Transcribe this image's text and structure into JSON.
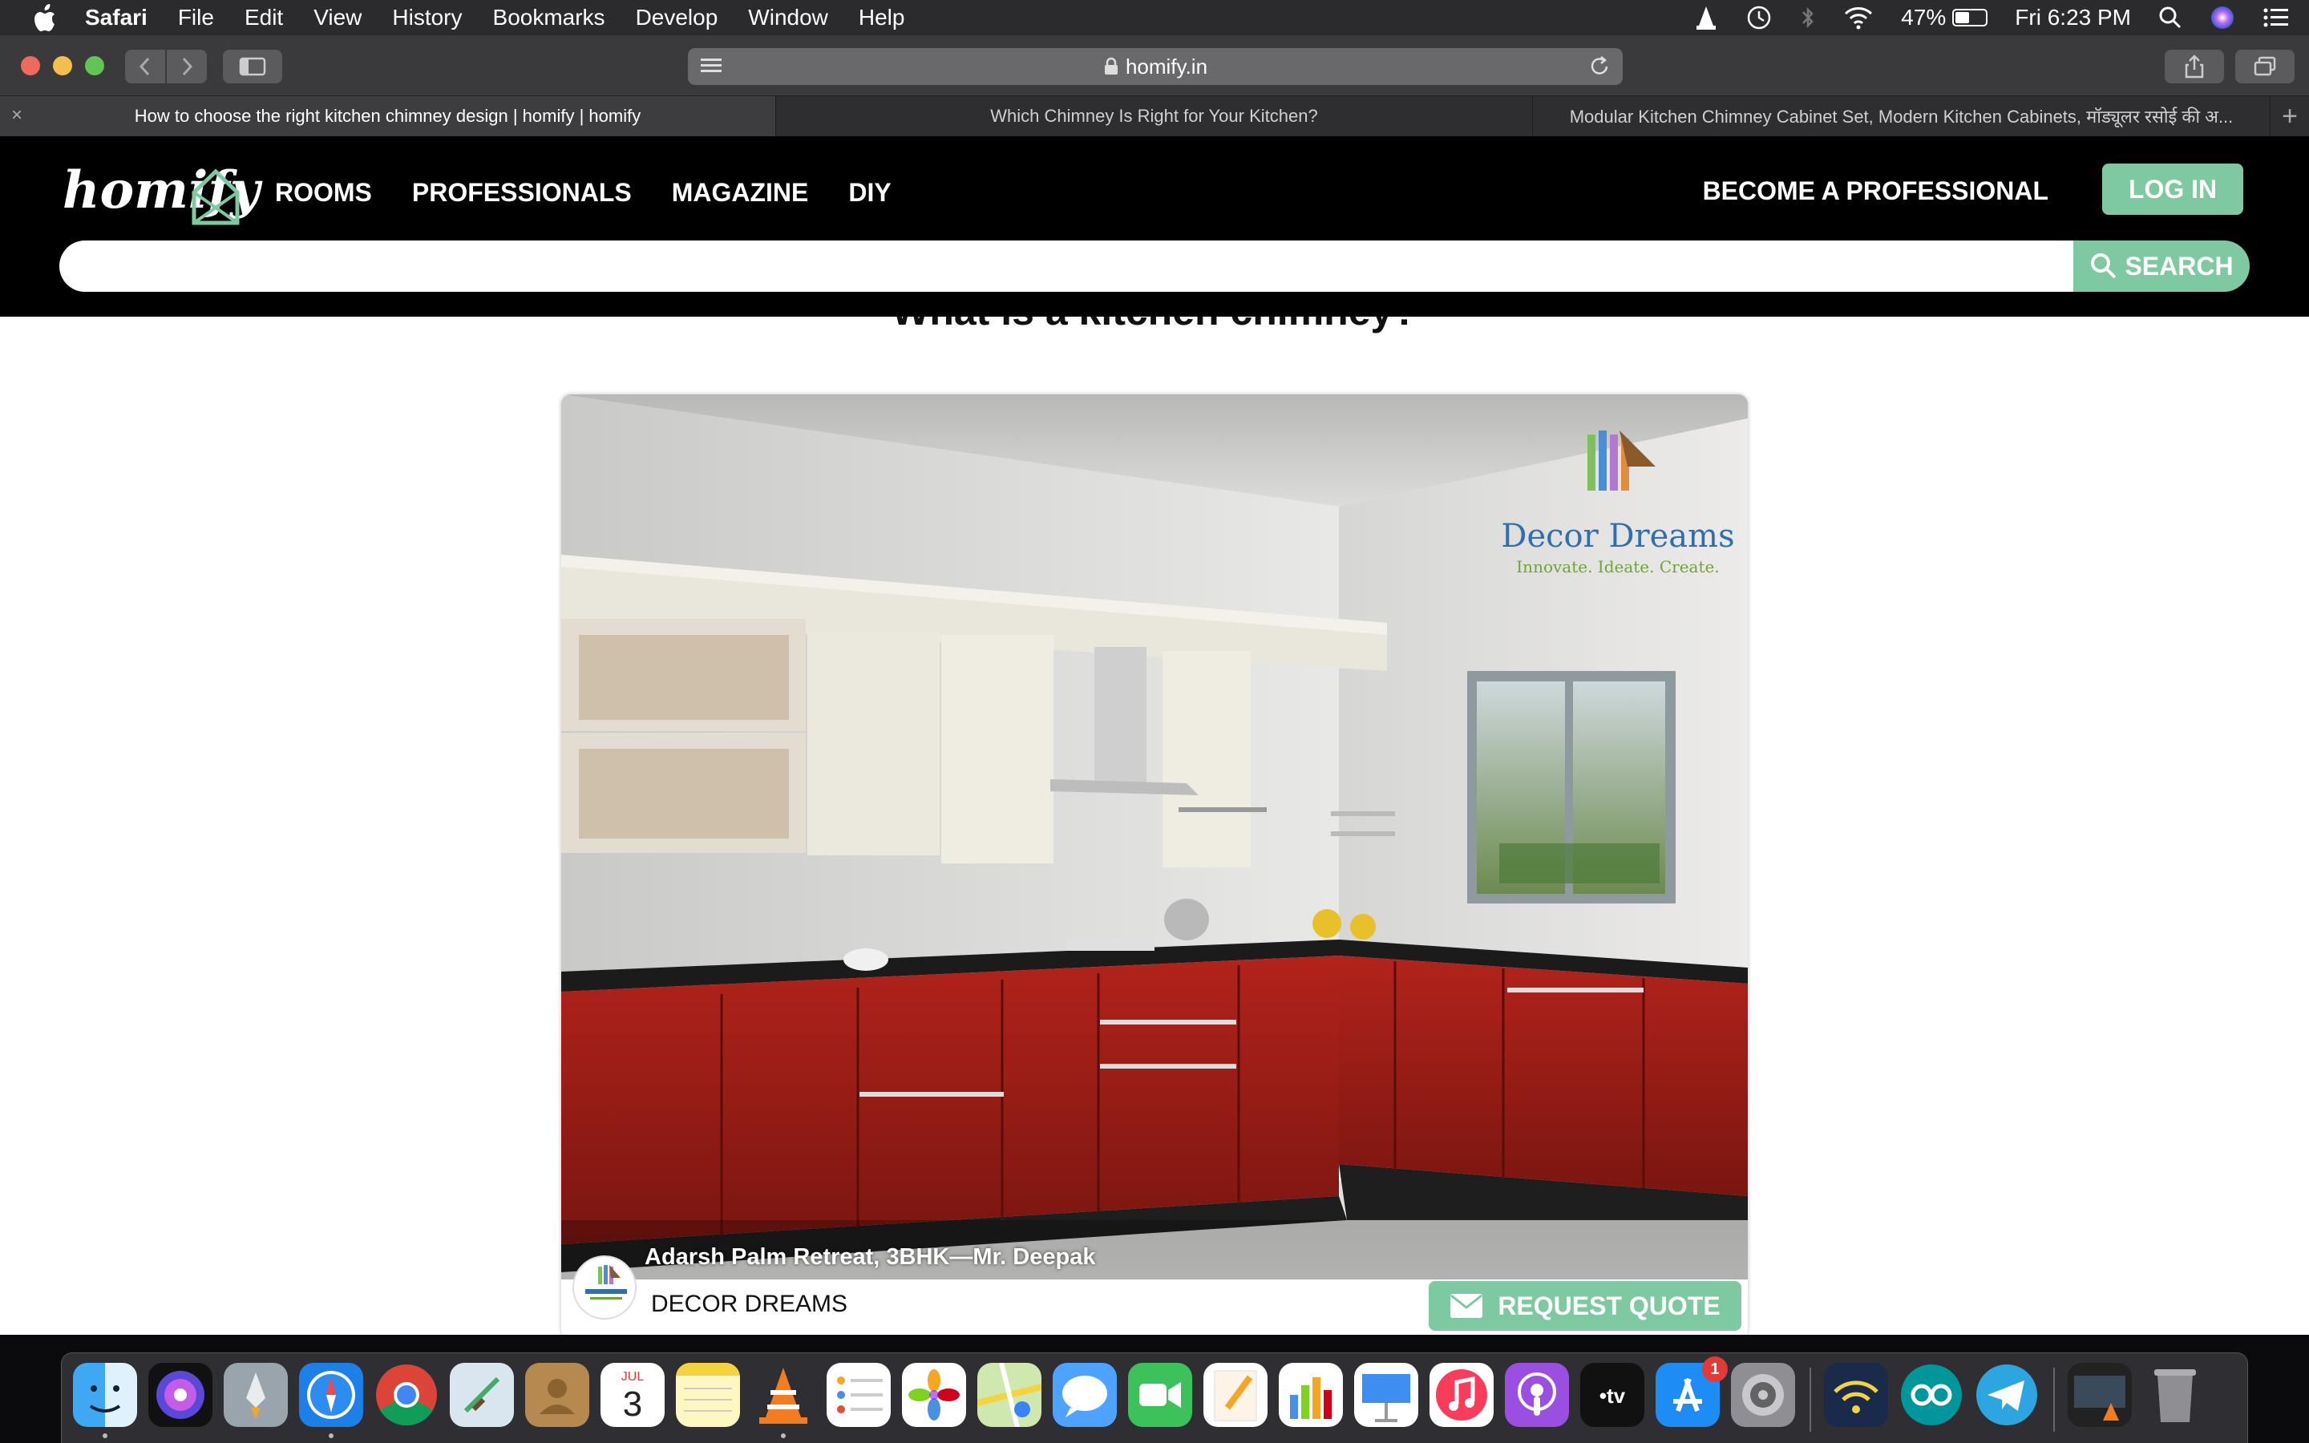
{
  "menubar": {
    "app_name": "Safari",
    "items": [
      "File",
      "Edit",
      "View",
      "History",
      "Bookmarks",
      "Develop",
      "Window",
      "Help"
    ],
    "battery_percent": "47%",
    "battery_level": 0.47,
    "clock": "Fri 6:23 PM"
  },
  "browser": {
    "url": "homify.in",
    "tabs": [
      {
        "title": "How to choose the right kitchen chimney design | homify | homify"
      },
      {
        "title": "Which Chimney Is Right for Your Kitchen?"
      },
      {
        "title": "Modular Kitchen Chimney Cabinet Set, Modern Kitchen Cabinets, मॉड्यूलर रसोई की अ..."
      }
    ]
  },
  "site": {
    "logo_text": "homify",
    "nav": [
      "ROOMS",
      "PROFESSIONALS",
      "MAGAZINE",
      "DIY"
    ],
    "become_professional": "BECOME A PROFESSIONAL",
    "login": "LOG IN",
    "search_placeholder": "",
    "search_button": "SEARCH"
  },
  "article": {
    "section_heading": "What is a kitchen chimney?",
    "photo": {
      "caption": "Adarsh Palm Retreat, 3BHK—Mr. Deepak",
      "watermark_brand": "Decor Dreams",
      "watermark_tagline": "Innovate. Ideate. Create.",
      "professional_name": "DECOR DREAMS",
      "request_quote": "REQUEST QUOTE"
    }
  },
  "dock": {
    "apps": [
      {
        "name": "Finder",
        "icon": "finder-icon",
        "running": true
      },
      {
        "name": "Siri",
        "icon": "siri-icon",
        "running": false
      },
      {
        "name": "Launchpad",
        "icon": "launchpad-icon",
        "running": false
      },
      {
        "name": "Safari",
        "icon": "safari-icon",
        "running": true
      },
      {
        "name": "Chrome",
        "icon": "chrome-icon",
        "running": false
      },
      {
        "name": "Mail",
        "icon": "mail-icon",
        "running": false
      },
      {
        "name": "Contacts",
        "icon": "contacts-icon",
        "running": false
      },
      {
        "name": "Calendar",
        "icon": "calendar-icon",
        "running": false,
        "month": "JUL",
        "day": "3"
      },
      {
        "name": "Notes",
        "icon": "notes-icon",
        "running": false
      },
      {
        "name": "VLC",
        "icon": "vlc-icon",
        "running": true
      },
      {
        "name": "Reminders",
        "icon": "reminders-icon",
        "running": false
      },
      {
        "name": "Photos",
        "icon": "photos-icon",
        "running": false
      },
      {
        "name": "Maps",
        "icon": "maps-icon",
        "running": false
      },
      {
        "name": "Messages",
        "icon": "messages-icon",
        "running": false
      },
      {
        "name": "FaceTime",
        "icon": "facetime-icon",
        "running": false
      },
      {
        "name": "Pages",
        "icon": "pages-icon",
        "running": false
      },
      {
        "name": "Numbers",
        "icon": "numbers-icon",
        "running": false
      },
      {
        "name": "Keynote",
        "icon": "keynote-icon",
        "running": false
      },
      {
        "name": "Music",
        "icon": "music-icon",
        "running": false
      },
      {
        "name": "Podcasts",
        "icon": "podcasts-icon",
        "running": false
      },
      {
        "name": "TV",
        "icon": "tv-icon",
        "running": false,
        "label": "tv"
      },
      {
        "name": "App Store",
        "icon": "app-store-icon",
        "running": false,
        "badge": "1"
      },
      {
        "name": "System Preferences",
        "icon": "system-preferences-icon",
        "running": false
      },
      {
        "name": "Wireless Diagnostics",
        "icon": "wifi-diagnostics-icon",
        "running": false
      },
      {
        "name": "Arduino",
        "icon": "arduino-icon",
        "running": false
      },
      {
        "name": "Telegram",
        "icon": "telegram-icon",
        "running": false
      },
      {
        "name": "Downloads Stack",
        "icon": "downloads-stack-icon",
        "running": false
      },
      {
        "name": "Trash",
        "icon": "trash-icon",
        "running": false
      }
    ]
  },
  "colors": {
    "brand_green": "#7ec9a2",
    "header_black": "#000000",
    "cabinet_red": "#9e1a14"
  }
}
